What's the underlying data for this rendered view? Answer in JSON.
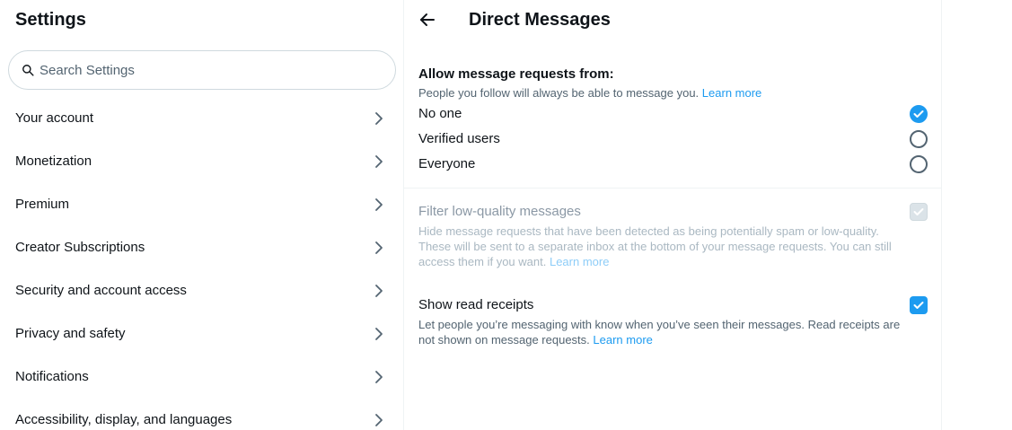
{
  "settings": {
    "title": "Settings",
    "search_placeholder": "Search Settings",
    "menu": [
      {
        "label": "Your account"
      },
      {
        "label": "Monetization"
      },
      {
        "label": "Premium"
      },
      {
        "label": "Creator Subscriptions"
      },
      {
        "label": "Security and account access"
      },
      {
        "label": "Privacy and safety"
      },
      {
        "label": "Notifications"
      },
      {
        "label": "Accessibility, display, and languages"
      }
    ]
  },
  "dm": {
    "title": "Direct Messages",
    "allow_title": "Allow message requests from:",
    "allow_sub": "People you follow will always be able to message you.",
    "learn_more": "Learn more",
    "options": [
      {
        "label": "No one",
        "selected": true
      },
      {
        "label": "Verified users",
        "selected": false
      },
      {
        "label": "Everyone",
        "selected": false
      }
    ],
    "filter": {
      "title": "Filter low-quality messages",
      "desc": "Hide message requests that have been detected as being potentially spam or low-quality. These will be sent to a separate inbox at the bottom of your message requests. You can still access them if you want.",
      "checked": true,
      "disabled": true
    },
    "receipts": {
      "title": "Show read receipts",
      "desc": "Let people you’re messaging with know when you’ve seen their messages. Read receipts are not shown on message requests.",
      "checked": true
    }
  },
  "colors": {
    "accent": "#1d9bf0",
    "text_primary": "#0f1419",
    "text_secondary": "#536471",
    "border": "#eff3f4"
  }
}
